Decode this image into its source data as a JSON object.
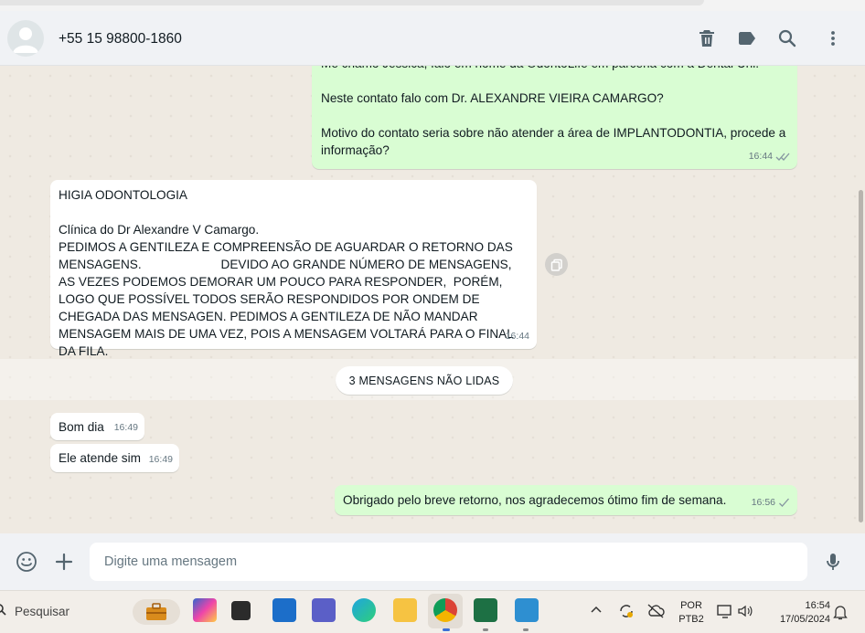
{
  "header": {
    "contact_name": "+55 15 98800-1860",
    "icons": [
      "delete-icon",
      "label-icon",
      "search-icon",
      "menu-icon"
    ]
  },
  "messages": {
    "m1": {
      "direction": "outgoing",
      "text": "Me chamo Jessica, falo em nome da OdontoLife em parceria com a Dental Uni.\n\nNeste contato falo com Dr. ALEXANDRE VIEIRA CAMARGO?\n\nMotivo do contato seria sobre não atender a área de IMPLANTODONTIA, procede a informação?",
      "time": "16:44"
    },
    "m2": {
      "direction": "incoming",
      "text": "HIGIA ODONTOLOGIA\n\nClínica do Dr Alexandre V Camargo.\nPEDIMOS A GENTILEZA E COMPREENSÃO DE AGUARDAR O RETORNO DAS MENSAGENS.                       DEVIDO AO GRANDE NÚMERO DE MENSAGENS, AS VEZES PODEMOS DEMORAR UM POUCO PARA RESPONDER,  PORÉM, LOGO QUE POSSÍVEL TODOS SERÃO RESPONDIDOS POR ONDEM DE CHEGADA DAS MENSAGEN. PEDIMOS A GENTILEZA DE NÃO MANDAR MENSAGEM MAIS DE UMA VEZ, POIS A MENSAGEM VOLTARÁ PARA O FINAL DA FILA.",
      "time": "16:44"
    },
    "unread_label": "3 MENSAGENS NÃO LIDAS",
    "m3": {
      "direction": "incoming",
      "text": "Bom dia",
      "time": "16:49"
    },
    "m4": {
      "direction": "incoming",
      "text": "Ele atende sim",
      "time": "16:49"
    },
    "m5": {
      "direction": "outgoing",
      "text": "Obrigado pelo breve retorno, nos agradecemos ótimo fim de semana.",
      "time": "16:56"
    }
  },
  "composer": {
    "placeholder": "Digite uma mensagem",
    "icons": [
      "emoji-icon",
      "plus-icon",
      "mic-icon"
    ]
  },
  "taskbar": {
    "search_label": "Pesquisar",
    "language": "POR",
    "layout": "PTB2",
    "clock_time": "16:54",
    "clock_date": "17/05/2024"
  },
  "colors": {
    "outgoing_bubble": "#d9fdd3",
    "incoming_bubble": "#ffffff",
    "chat_background": "#efeae2",
    "header_background": "#f0f2f5",
    "read_tick": "#53bdeb"
  }
}
